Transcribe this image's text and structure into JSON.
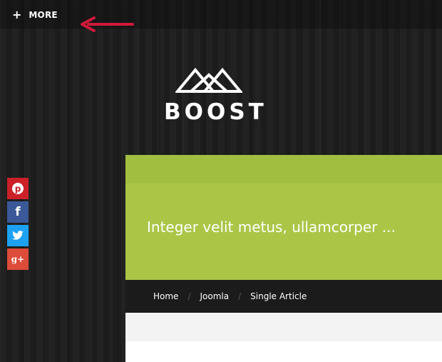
{
  "topbar": {
    "more_icon": "plus-icon",
    "more_label": "MORE"
  },
  "annotation": {
    "arrow_color": "#d0193b"
  },
  "logo": {
    "text": "BOOST"
  },
  "social": {
    "items": [
      {
        "name": "pinterest",
        "glyph": "P",
        "color": "#cb2027"
      },
      {
        "name": "facebook",
        "glyph": "f",
        "color": "#3b5998"
      },
      {
        "name": "twitter",
        "glyph": "t",
        "color": "#1da1f2"
      },
      {
        "name": "google-plus",
        "glyph": "g+",
        "color": "#dd4b39"
      }
    ]
  },
  "hero": {
    "title": "Integer velit metus, ullamcorper ...",
    "color": "#abc647"
  },
  "breadcrumb": {
    "items": [
      "Home",
      "Joomla",
      "Single Article"
    ],
    "separator": "/"
  }
}
